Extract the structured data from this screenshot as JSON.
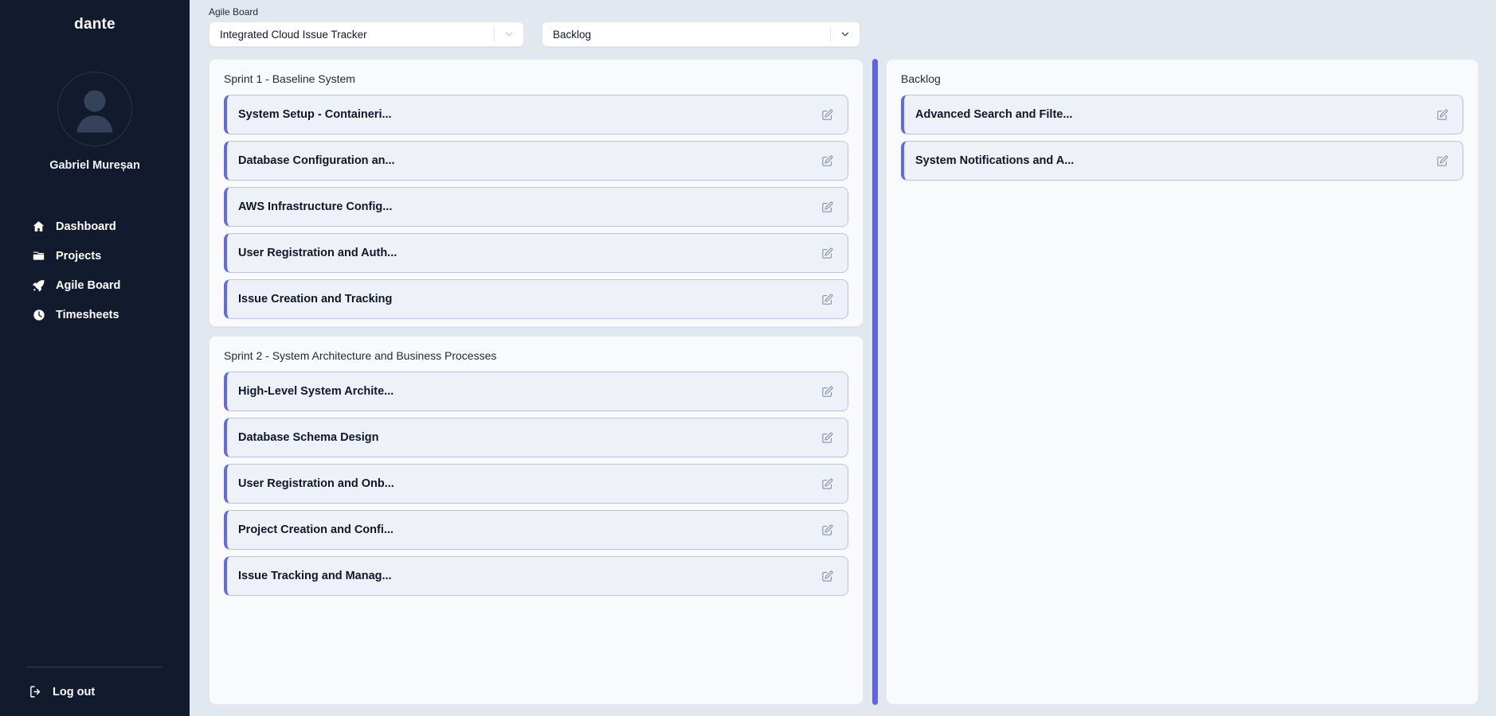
{
  "sidebar": {
    "brand": "dante",
    "profile_name": "Gabriel Mureșan",
    "avatar_icon": "user-avatar-icon",
    "nav": [
      {
        "label": "Dashboard",
        "icon": "home-icon"
      },
      {
        "label": "Projects",
        "icon": "folder-icon"
      },
      {
        "label": "Agile Board",
        "icon": "rocket-icon"
      },
      {
        "label": "Timesheets",
        "icon": "clock-icon"
      }
    ],
    "logout": {
      "label": "Log out",
      "icon": "logout-icon"
    }
  },
  "topbar": {
    "label": "Agile Board",
    "project_select": {
      "value": "Integrated Cloud Issue Tracker",
      "icon": "chevron-down-icon"
    },
    "view_select": {
      "value": "Backlog",
      "icon": "chevron-down-icon"
    }
  },
  "board": {
    "edit_icon": "edit-pencil-icon",
    "scrollbar": {
      "name": "board-scrollbar",
      "color": "#5d62ef"
    },
    "columns": [
      {
        "name": "sprints-column",
        "panels": [
          {
            "title": "Sprint 1 - Baseline System",
            "issues": [
              {
                "title": "System Setup - Containeri..."
              },
              {
                "title": "Database Configuration an..."
              },
              {
                "title": "AWS Infrastructure Config..."
              },
              {
                "title": "User Registration and Auth..."
              },
              {
                "title": "Issue Creation and Tracking"
              }
            ]
          },
          {
            "title": "Sprint 2 - System Architecture and Business Processes",
            "issues": [
              {
                "title": "High-Level System Archite..."
              },
              {
                "title": "Database Schema Design"
              },
              {
                "title": "User Registration and Onb..."
              },
              {
                "title": "Project Creation and Confi..."
              },
              {
                "title": "Issue Tracking and Manag..."
              }
            ]
          }
        ]
      },
      {
        "name": "backlog-column",
        "panels": [
          {
            "title": "Backlog",
            "issues": [
              {
                "title": "Advanced Search and Filte..."
              },
              {
                "title": "System Notifications and A..."
              }
            ]
          }
        ]
      }
    ]
  },
  "colors": {
    "sidebar_bg": "#121b2e",
    "page_bg": "#e2e8f0",
    "panel_bg": "#f8fafc",
    "card_bg": "#eef2f8",
    "accent": "#6168ea",
    "scrollbar": "#5d62ef"
  }
}
